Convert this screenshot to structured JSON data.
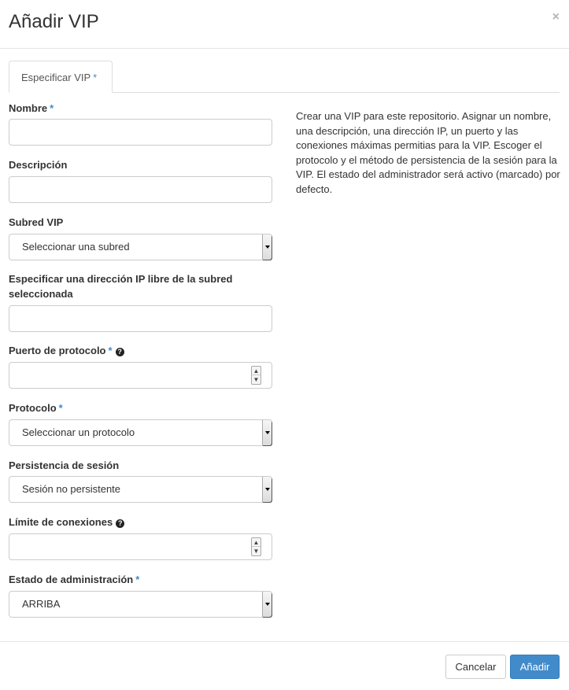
{
  "modal": {
    "title": "Añadir VIP",
    "close_symbol": "×"
  },
  "tabs": [
    {
      "label": "Especificar VIP",
      "required": "*"
    }
  ],
  "form": {
    "name": {
      "label": "Nombre",
      "required": "*",
      "value": ""
    },
    "description": {
      "label": "Descripción",
      "value": ""
    },
    "subnet": {
      "label": "Subred VIP",
      "selected": "Seleccionar una subred"
    },
    "ip": {
      "label": "Especificar una dirección IP libre de la subred seleccionada",
      "value": ""
    },
    "port": {
      "label": "Puerto de protocolo",
      "required": "*",
      "help_icon": "?",
      "value": ""
    },
    "protocol": {
      "label": "Protocolo",
      "required": "*",
      "selected": "Seleccionar un protocolo"
    },
    "persistence": {
      "label": "Persistencia de sesión",
      "selected": "Sesión no persistente"
    },
    "conn_limit": {
      "label": "Límite de conexiones",
      "help_icon": "?",
      "value": ""
    },
    "admin_state": {
      "label": "Estado de administración",
      "required": "*",
      "selected": "ARRIBA"
    }
  },
  "help_text": "Crear una VIP para este repositorio. Asignar un nombre, una descripción, una dirección IP, un puerto y las conexiones máximas permitias para la VIP. Escoger el protocolo y el método de persistencia de la sesión para la VIP. El estado del administrador será activo (marcado) por defecto.",
  "footer": {
    "cancel_label": "Cancelar",
    "submit_label": "Añadir"
  },
  "icons": {
    "spin_up": "▲",
    "spin_down": "▼"
  },
  "colors": {
    "primary": "#428bca",
    "required_marker": "#428bca"
  }
}
